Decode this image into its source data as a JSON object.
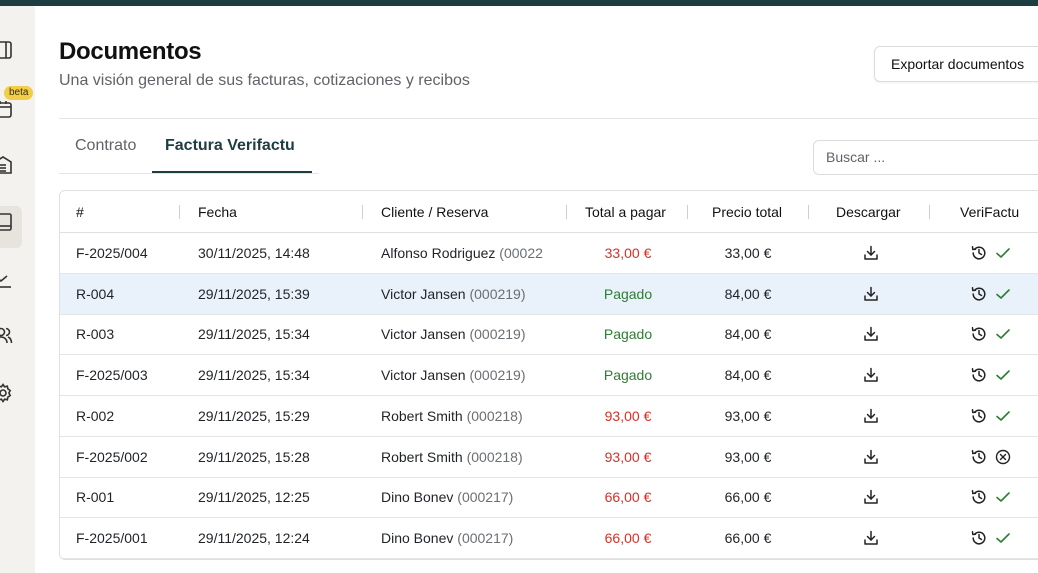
{
  "header": {
    "title": "Documentos",
    "subtitle": "Una visión general de sus facturas, cotizaciones y recibos",
    "export_label": "Exportar documentos"
  },
  "sidebar": {
    "beta_label": "beta",
    "items": [
      {
        "icon": "book-icon"
      },
      {
        "icon": "calendar-icon"
      },
      {
        "icon": "building-icon"
      },
      {
        "icon": "document-icon"
      },
      {
        "icon": "chart-icon"
      },
      {
        "icon": "users-icon"
      },
      {
        "icon": "gear-icon"
      }
    ]
  },
  "tabs": [
    {
      "label": "Contrato"
    },
    {
      "label": "Factura Verifactu",
      "active": true
    }
  ],
  "search": {
    "placeholder": "Buscar ..."
  },
  "table": {
    "columns": [
      "#",
      "Fecha",
      "Cliente / Reserva",
      "Total a pagar",
      "Precio total",
      "Descargar",
      "VeriFactu"
    ],
    "rows": [
      {
        "id": "F-2025/004",
        "date": "30/11/2025, 14:48",
        "client": "Alfonso Rodriguez",
        "code": "(00022",
        "due": "33,00 €",
        "due_status": "unpaid",
        "total": "33,00 €",
        "verifactu": "ok"
      },
      {
        "id": "R-004",
        "date": "29/11/2025, 15:39",
        "client": "Victor Jansen",
        "code": "(000219)",
        "due": "Pagado",
        "due_status": "paid",
        "total": "84,00 €",
        "verifactu": "ok",
        "selected": true
      },
      {
        "id": "R-003",
        "date": "29/11/2025, 15:34",
        "client": "Victor Jansen",
        "code": "(000219)",
        "due": "Pagado",
        "due_status": "paid",
        "total": "84,00 €",
        "verifactu": "ok"
      },
      {
        "id": "F-2025/003",
        "date": "29/11/2025, 15:34",
        "client": "Victor Jansen",
        "code": "(000219)",
        "due": "Pagado",
        "due_status": "paid",
        "total": "84,00 €",
        "verifactu": "ok"
      },
      {
        "id": "R-002",
        "date": "29/11/2025, 15:29",
        "client": "Robert Smith",
        "code": "(000218)",
        "due": "93,00 €",
        "due_status": "unpaid",
        "total": "93,00 €",
        "verifactu": "ok"
      },
      {
        "id": "F-2025/002",
        "date": "29/11/2025, 15:28",
        "client": "Robert Smith",
        "code": "(000218)",
        "due": "93,00 €",
        "due_status": "unpaid",
        "total": "93,00 €",
        "verifactu": "error"
      },
      {
        "id": "R-001",
        "date": "29/11/2025, 12:25",
        "client": "Dino Bonev",
        "code": "(000217)",
        "due": "66,00 €",
        "due_status": "unpaid",
        "total": "66,00 €",
        "verifactu": "ok"
      },
      {
        "id": "F-2025/001",
        "date": "29/11/2025, 12:24",
        "client": "Dino Bonev",
        "code": "(000217)",
        "due": "66,00 €",
        "due_status": "unpaid",
        "total": "66,00 €",
        "verifactu": "ok"
      }
    ]
  },
  "colors": {
    "brand": "#1e3d40",
    "unpaid": "#d93025",
    "paid": "#2e7d32",
    "selected_row": "#e9f2fb",
    "beta_badge": "#f3cc4a"
  }
}
